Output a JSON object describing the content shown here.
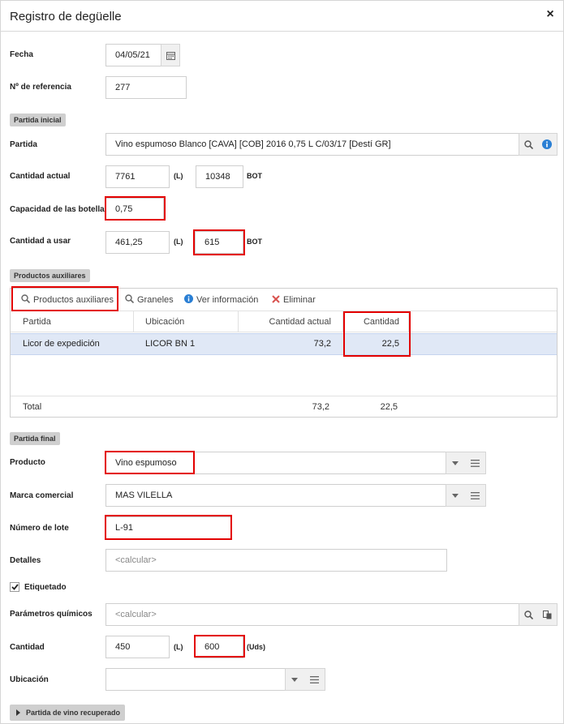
{
  "dialog": {
    "title": "Registro de degüelle",
    "close_label": "×"
  },
  "fecha": {
    "label": "Fecha",
    "value": "04/05/21"
  },
  "referencia": {
    "label": "Nº de referencia",
    "value": "277"
  },
  "partida_inicial": {
    "section": "Partida inicial",
    "partida_label": "Partida",
    "partida_value": "Vino espumoso Blanco [CAVA] [COB] 2016 0,75 L C/03/17 [Destí GR]",
    "cantidad_actual_label": "Cantidad actual",
    "cantidad_actual_l": "7761",
    "cantidad_actual_bot": "10348",
    "capacidad_label": "Capacidad de las botellas",
    "capacidad_value": "0,75",
    "cantidad_usar_label": "Cantidad a usar",
    "cantidad_usar_l": "461,25",
    "cantidad_usar_bot": "615",
    "unit_l": "(L)",
    "unit_bot": "BOT"
  },
  "productos_auxiliares": {
    "section": "Productos auxiliares",
    "toolbar": {
      "productos": "Productos auxiliares",
      "graneles": "Graneles",
      "ver_info": "Ver información",
      "eliminar": "Eliminar"
    },
    "columns": [
      "Partida",
      "Ubicación",
      "Cantidad actual",
      "Cantidad"
    ],
    "rows": [
      {
        "partida": "Licor de expedición",
        "ubicacion": "LICOR BN 1",
        "cantidad_actual": "73,2",
        "cantidad": "22,5"
      }
    ],
    "footer": {
      "label": "Total",
      "cantidad_actual": "73,2",
      "cantidad": "22,5"
    }
  },
  "partida_final": {
    "section": "Partida final",
    "producto_label": "Producto",
    "producto_value": "Vino espumoso",
    "marca_label": "Marca comercial",
    "marca_value": "MAS VILELLA",
    "lote_label": "Número de lote",
    "lote_value": "L-91",
    "detalles_label": "Detalles",
    "detalles_placeholder": "<calcular>",
    "etiquetado_label": "Etiquetado",
    "etiquetado_checked": true,
    "parametros_label": "Parámetros químicos",
    "parametros_placeholder": "<calcular>",
    "cantidad_label": "Cantidad",
    "cantidad_l": "450",
    "cantidad_uds": "600",
    "unit_l": "(L)",
    "unit_uds": "(Uds)",
    "ubicacion_label": "Ubicación",
    "ubicacion_value": ""
  },
  "recuperado": {
    "label": "Partida de vino recuperado"
  },
  "colors": {
    "highlight": "#e30000",
    "info_blue": "#2a7fd4",
    "delete_red": "#d9534f",
    "selected_row": "#e0e8f6"
  }
}
